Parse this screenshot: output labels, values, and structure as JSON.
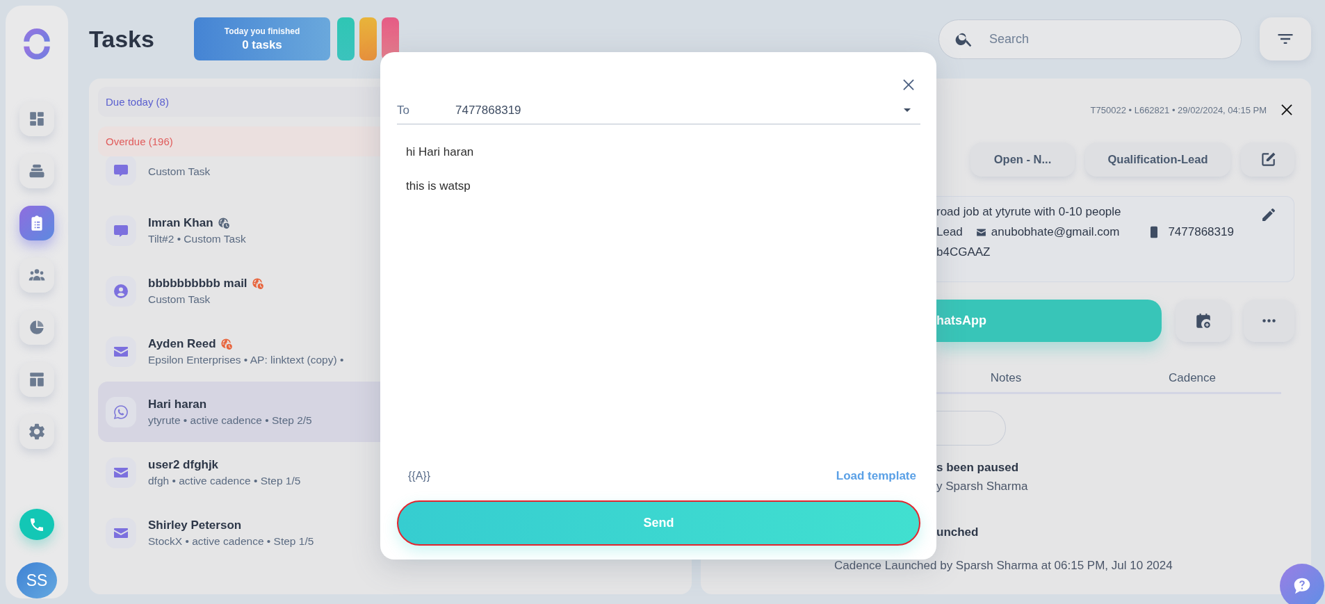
{
  "sidebar": {
    "items": [
      {
        "kind": "dashboard",
        "selected": false
      },
      {
        "kind": "inbox",
        "selected": false
      },
      {
        "kind": "tasks",
        "selected": true
      },
      {
        "kind": "people",
        "selected": false
      },
      {
        "kind": "reports",
        "selected": false
      },
      {
        "kind": "layout",
        "selected": false
      },
      {
        "kind": "settings",
        "selected": false
      }
    ],
    "avatar": "SS"
  },
  "header": {
    "title": "Tasks",
    "stat": {
      "label": "Today you finished",
      "value": "0 tasks"
    },
    "search": {
      "placeholder": "Search"
    }
  },
  "task_list": {
    "groups": [
      {
        "kind": "due",
        "label": "Due today (8)"
      },
      {
        "kind": "overdue",
        "label": "Overdue (196)"
      }
    ],
    "items": [
      {
        "kind": "chat",
        "subtitle": "Custom Task",
        "selected": false
      },
      {
        "kind": "chat",
        "title": "Imran Khan",
        "subtitle": "Tilt#2 • Custom Task",
        "color": "#56657a",
        "selected": false
      },
      {
        "kind": "person",
        "title": "bbbbbbbbbb mail",
        "subtitle": "Custom Task",
        "color": "#e8643c",
        "selected": false
      },
      {
        "kind": "mail",
        "title": "Ayden Reed",
        "subtitle": "Epsilon Enterprises • AP: linktext (copy) •",
        "color": "#e8643c",
        "selected": false
      },
      {
        "kind": "whatsapp",
        "title": "Hari haran",
        "subtitle": "ytyrute • active cadence • Step 2/5",
        "selected": true
      },
      {
        "kind": "mail",
        "title": "user2 dfghjk",
        "subtitle": "dfgh • active cadence • Step 1/5",
        "selected": false
      },
      {
        "kind": "mail",
        "title": "Shirley Peterson",
        "subtitle": "StockX • active cadence • Step 1/5",
        "selected": false
      }
    ]
  },
  "detail": {
    "meta": "T750022 • L662821 • 29/02/2024, 04:15 PM",
    "chips": [
      "Open - N...",
      "Qualification-Lead"
    ],
    "info": {
      "line_1": "road job at ytyrute with 0-10 people",
      "role": "Lead",
      "email": "anubobhate@gmail.com",
      "phone": "7477868319",
      "line_3": "b4CGAAZ"
    },
    "action": "hatsApp",
    "tabs": [
      {
        "label": "Notes",
        "selected": false
      },
      {
        "label": "Cadence",
        "selected": false
      }
    ],
    "timeline": [
      {
        "title": "s been paused",
        "text": "y Sparsh Sharma"
      },
      {
        "title": "unched",
        "text": "Cadence Launched by Sparsh Sharma at 06:15 PM, Jul 10 2024"
      }
    ]
  },
  "modal": {
    "to_label": "To",
    "to_value": "7477868319",
    "message": [
      "hi Hari haran",
      "this is watsp"
    ],
    "variable": "{{A}}",
    "load_template": "Load template",
    "send": "Send"
  }
}
